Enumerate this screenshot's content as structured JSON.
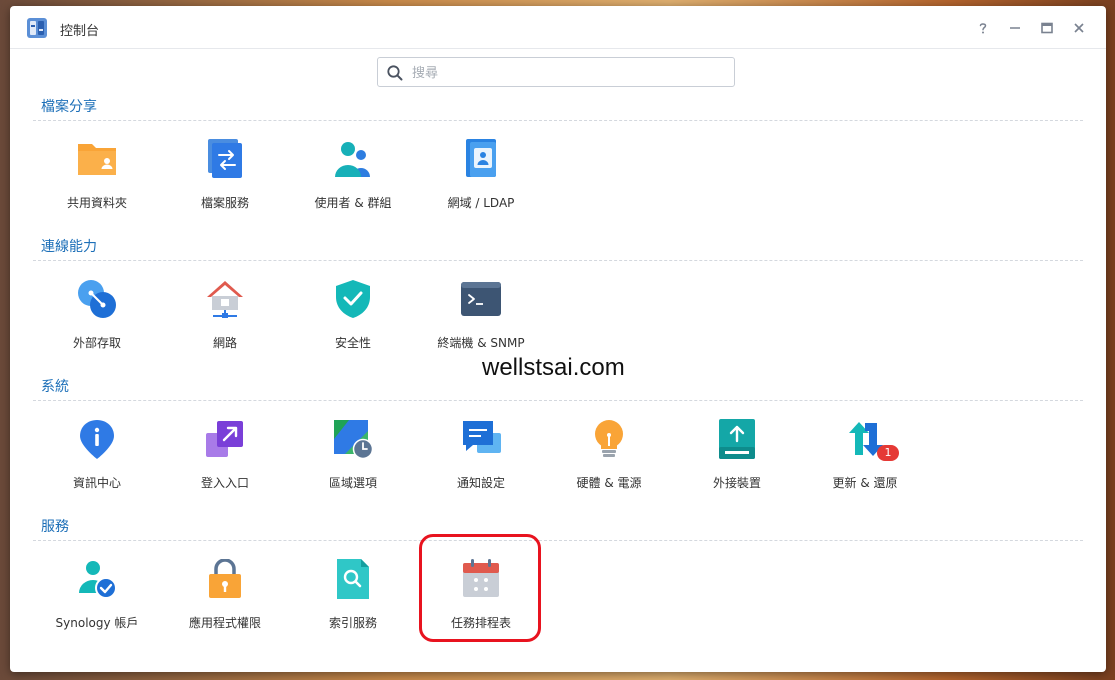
{
  "window": {
    "title": "控制台"
  },
  "search": {
    "placeholder": "搜尋"
  },
  "sections": {
    "file_sharing": {
      "title": "檔案分享",
      "items": [
        "共用資料夾",
        "檔案服務",
        "使用者 & 群組",
        "網域 / LDAP"
      ]
    },
    "connectivity": {
      "title": "連線能力",
      "items": [
        "外部存取",
        "網路",
        "安全性",
        "終端機 & SNMP"
      ]
    },
    "system": {
      "title": "系統",
      "items": [
        "資訊中心",
        "登入入口",
        "區域選項",
        "通知設定",
        "硬體 & 電源",
        "外接裝置",
        "更新 & 還原"
      ],
      "update_badge": "1"
    },
    "services": {
      "title": "服務",
      "items": [
        "Synology 帳戶",
        "應用程式權限",
        "索引服務",
        "任務排程表"
      ]
    }
  },
  "watermark": "wellstsai.com",
  "colors": {
    "section_title": "#1c6fb8",
    "highlight": "#e8131f",
    "badge": "#e53935"
  }
}
